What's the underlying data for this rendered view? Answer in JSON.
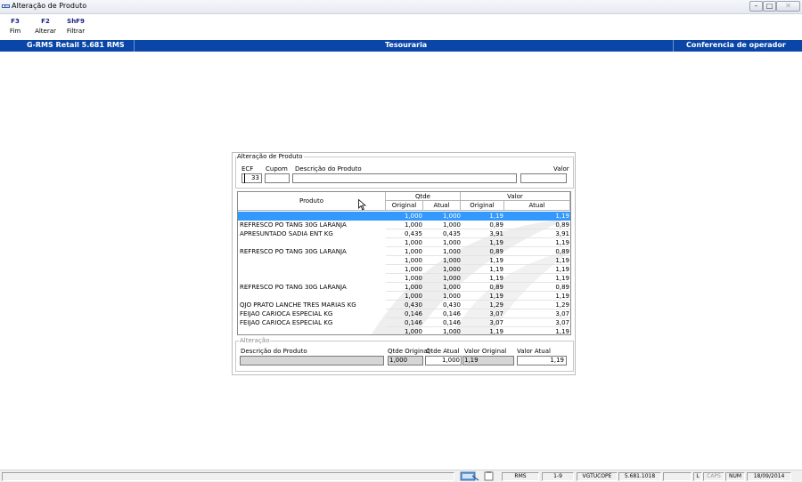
{
  "window": {
    "title": "Alteração de Produto",
    "minimize_icon": "minimize-icon",
    "maximize_icon": "maximize-icon",
    "close_icon": "close-icon"
  },
  "toolbar": {
    "keys": [
      {
        "key": "F3",
        "label": "Fim"
      },
      {
        "key": "F2",
        "label": "Alterar"
      },
      {
        "key": "ShF9",
        "label": "Filtrar"
      }
    ]
  },
  "header": {
    "left": "G-RMS Retail 5.681 RMS",
    "center": "Tesouraria",
    "right": "Conferencia de operador",
    "color": "#0a46a8"
  },
  "dialog": {
    "group_title": "Alteração de Produto",
    "ecf_label": "ECF",
    "cupom_label": "Cupom",
    "descricao_label": "Descrição do Produto",
    "valor_label": "Valor",
    "ecf_value": "",
    "cupom_value": "33",
    "descricao_value": "",
    "valor_value": "",
    "grid": {
      "col_produto": "Produto",
      "col_qtde": "Qtde",
      "col_valor": "Valor",
      "sub_original": "Original",
      "sub_atual": "Atual",
      "rows": [
        {
          "produto": "",
          "qtde_original": "1,000",
          "qtde_atual": "1,000",
          "valor_original": "1,19",
          "valor_atual": "1,19",
          "selected": true
        },
        {
          "produto": "REFRESCO PO TANG 30G LARANJA",
          "qtde_original": "1,000",
          "qtde_atual": "1,000",
          "valor_original": "0,89",
          "valor_atual": "0,89"
        },
        {
          "produto": "APRESUNTADO SADIA ENT KG",
          "qtde_original": "0,435",
          "qtde_atual": "0,435",
          "valor_original": "3,91",
          "valor_atual": "3,91"
        },
        {
          "produto": "",
          "qtde_original": "1,000",
          "qtde_atual": "1,000",
          "valor_original": "1,19",
          "valor_atual": "1,19"
        },
        {
          "produto": "REFRESCO PO TANG 30G LARANJA",
          "qtde_original": "1,000",
          "qtde_atual": "1,000",
          "valor_original": "0,89",
          "valor_atual": "0,89"
        },
        {
          "produto": "",
          "qtde_original": "1,000",
          "qtde_atual": "1,000",
          "valor_original": "1,19",
          "valor_atual": "1,19"
        },
        {
          "produto": "",
          "qtde_original": "1,000",
          "qtde_atual": "1,000",
          "valor_original": "1,19",
          "valor_atual": "1,19"
        },
        {
          "produto": "",
          "qtde_original": "1,000",
          "qtde_atual": "1,000",
          "valor_original": "1,19",
          "valor_atual": "1,19"
        },
        {
          "produto": "REFRESCO PO TANG 30G LARANJA",
          "qtde_original": "1,000",
          "qtde_atual": "1,000",
          "valor_original": "0,89",
          "valor_atual": "0,89"
        },
        {
          "produto": "",
          "qtde_original": "1,000",
          "qtde_atual": "1,000",
          "valor_original": "1,19",
          "valor_atual": "1,19"
        },
        {
          "produto": "QJO PRATO LANCHE TRES MARIAS KG",
          "qtde_original": "0,430",
          "qtde_atual": "0,430",
          "valor_original": "1,29",
          "valor_atual": "1,29"
        },
        {
          "produto": "FEIJAO CARIOCA ESPECIAL  KG",
          "qtde_original": "0,146",
          "qtde_atual": "0,146",
          "valor_original": "3,07",
          "valor_atual": "3,07"
        },
        {
          "produto": "FEIJAO CARIOCA ESPECIAL  KG",
          "qtde_original": "0,146",
          "qtde_atual": "0,146",
          "valor_original": "3,07",
          "valor_atual": "3,07"
        },
        {
          "produto": "",
          "qtde_original": "1,000",
          "qtde_atual": "1,000",
          "valor_original": "1,19",
          "valor_atual": "1,19"
        }
      ]
    },
    "alteracao": {
      "group_title": "Alteração",
      "descricao_label": "Descrição do Produto",
      "qtde_original_label": "Qtde Original",
      "qtde_atual_label": "Qtde Atual",
      "valor_original_label": "Valor Original",
      "valor_atual_label": "Valor Atual",
      "descricao_value": "",
      "qtde_original_value": "1,000",
      "qtde_atual_value": "1,000",
      "valor_original_value": "1,19",
      "valor_atual_value": "1,19"
    }
  },
  "statusbar": {
    "panels": [
      "RMS",
      "1-9",
      "VGTUCOPE",
      "5.681.1018",
      "",
      "L",
      "CAPS",
      "NUM",
      "18/09/2014"
    ]
  }
}
